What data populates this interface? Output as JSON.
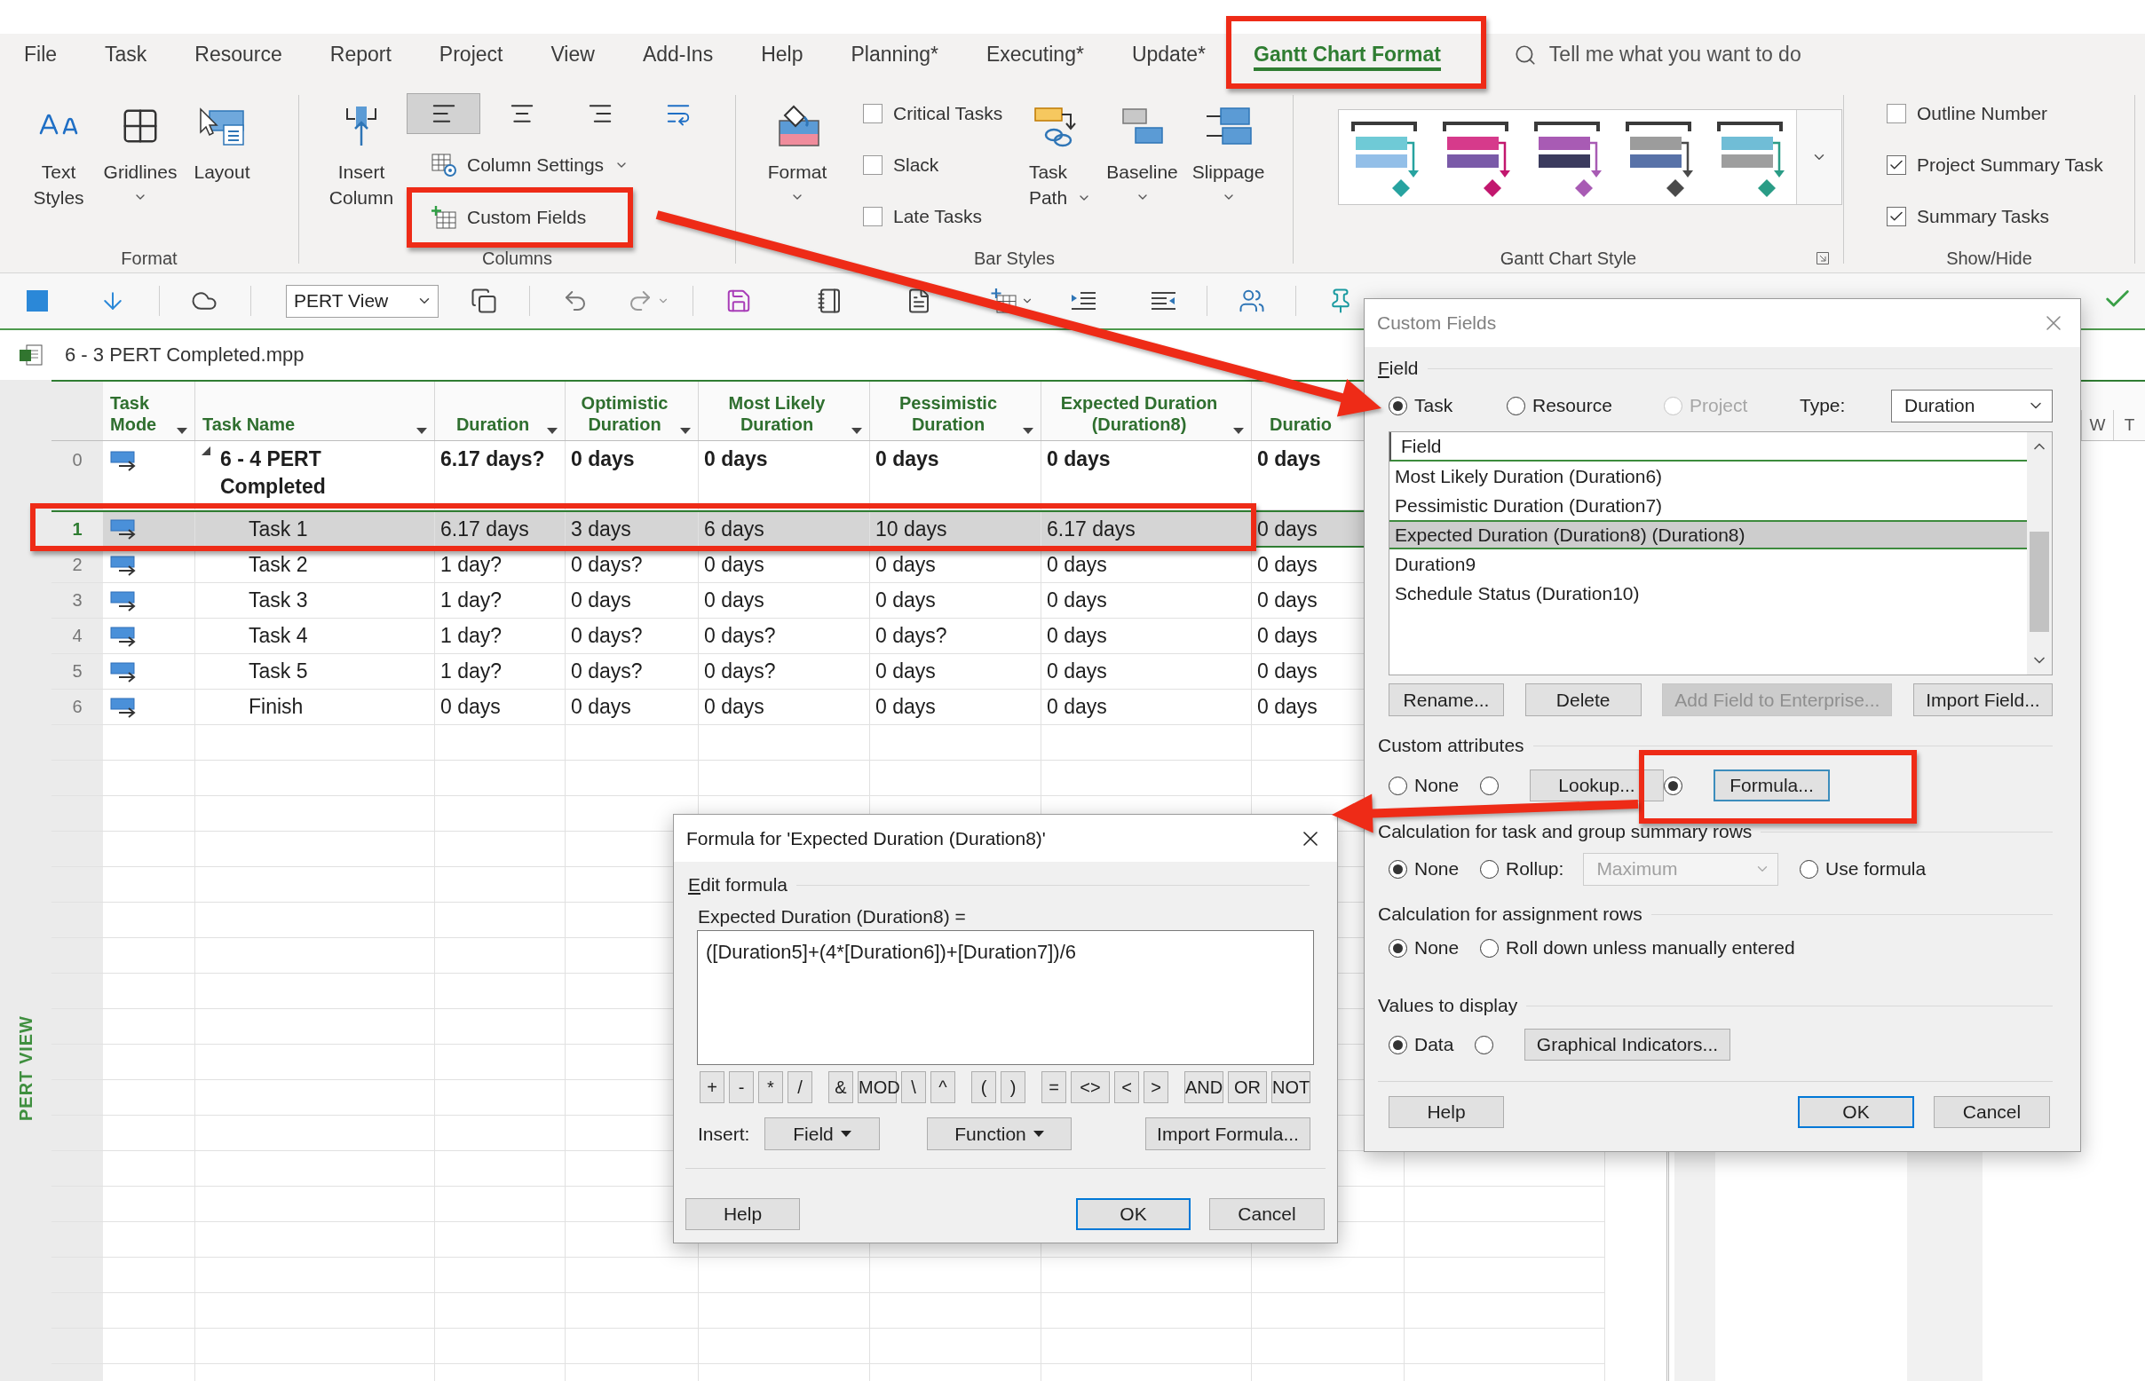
{
  "menu": {
    "tabs": [
      {
        "label": "File",
        "selected": false
      },
      {
        "label": "Task",
        "selected": false
      },
      {
        "label": "Resource",
        "selected": false
      },
      {
        "label": "Report",
        "selected": false
      },
      {
        "label": "Project",
        "selected": false
      },
      {
        "label": "View",
        "selected": false
      },
      {
        "label": "Add-Ins",
        "selected": false
      },
      {
        "label": "Help",
        "selected": false
      },
      {
        "label": "Planning*",
        "selected": false
      },
      {
        "label": "Executing*",
        "selected": false
      },
      {
        "label": "Update*",
        "selected": false
      },
      {
        "label": "Gantt Chart Format",
        "selected": true
      }
    ],
    "search": {
      "placeholder": "Tell me what you want to do"
    }
  },
  "ribbon": {
    "format": {
      "label": "Format",
      "buttons": [
        {
          "kind": "text_styles",
          "label": "Text Styles",
          "dropdown": false
        },
        {
          "kind": "gridlines",
          "label": "Gridlines",
          "dropdown": true
        },
        {
          "kind": "layout",
          "label": "Layout",
          "dropdown": false
        }
      ]
    },
    "columns": {
      "label": "Columns",
      "insert_column": "Insert Column",
      "alignment": [
        {
          "kind": "left",
          "selected": true
        },
        {
          "kind": "center",
          "selected": false
        },
        {
          "kind": "right",
          "selected": false
        }
      ],
      "column_settings": "Column Settings",
      "custom_fields": "Custom Fields"
    },
    "bar_styles": {
      "label": "Bar Styles",
      "format": {
        "label": "Format",
        "dropdown": true
      },
      "checkboxes": [
        {
          "label": "Critical Tasks",
          "checked": false
        },
        {
          "label": "Slack",
          "checked": false
        },
        {
          "label": "Late Tasks",
          "checked": false
        }
      ],
      "buttons": [
        {
          "kind": "task_path",
          "label": "Task Path",
          "dropdown": true
        },
        {
          "kind": "baseline",
          "label": "Baseline",
          "dropdown": true
        },
        {
          "kind": "slippage",
          "label": "Slippage",
          "dropdown": true
        }
      ]
    },
    "gantt_style": {
      "label": "Gantt Chart Style",
      "styles": [
        {
          "bars": [
            {
              "color": "#6fcad6"
            },
            {
              "color": "#93bfe8"
            }
          ],
          "milestone": {
            "color": "#27a3a0"
          }
        },
        {
          "bars": [
            {
              "color": "#d63a8b"
            },
            {
              "color": "#7a5aa8"
            }
          ],
          "milestone": {
            "color": "#c2176e"
          }
        },
        {
          "bars": [
            {
              "color": "#a85bb4"
            },
            {
              "color": "#3b3b5e"
            }
          ],
          "milestone": {
            "color": "#a85bb4"
          }
        },
        {
          "bars": [
            {
              "color": "#9c9c9c"
            },
            {
              "color": "#5872a8"
            }
          ],
          "milestone": {
            "color": "#4a4a4a"
          }
        },
        {
          "bars": [
            {
              "color": "#70bdd6"
            },
            {
              "color": "#9e9e9e"
            }
          ],
          "milestone": {
            "color": "#2a9c86"
          }
        }
      ]
    },
    "show_hide": {
      "label": "Show/Hide",
      "checkboxes": [
        {
          "label": "Outline Number",
          "checked": false
        },
        {
          "label": "Project Summary Task",
          "checked": true
        },
        {
          "label": "Summary Tasks",
          "checked": true
        }
      ]
    }
  },
  "quick_toolbar": {
    "view": "PERT View"
  },
  "document": {
    "file_name": "6 - 3 PERT Completed.mpp",
    "view_label": "PERT VIEW"
  },
  "table": {
    "columns": [
      {
        "label": "Task Mode",
        "menu": true
      },
      {
        "label": "Task Name",
        "menu": true
      },
      {
        "label": "Duration",
        "menu": true
      },
      {
        "label": "Optimistic Duration",
        "menu": true
      },
      {
        "label": "Most Likely Duration",
        "menu": true
      },
      {
        "label": "Pessimistic Duration",
        "menu": true
      },
      {
        "label": "Expected Duration (Duration8)",
        "menu": true
      },
      {
        "label": "Duratio",
        "menu": false
      }
    ],
    "rows": [
      {
        "id": "0",
        "kind": "summary",
        "selected": false,
        "name": "6 - 4 PERT Completed",
        "values": [
          "6.17 days?",
          "0 days",
          "0 days",
          "0 days",
          "0 days",
          "0 days"
        ]
      },
      {
        "id": "1",
        "kind": "task",
        "selected": true,
        "name": "Task 1",
        "values": [
          "6.17 days",
          "3 days",
          "6 days",
          "10 days",
          "6.17 days",
          "0 days"
        ]
      },
      {
        "id": "2",
        "kind": "task",
        "selected": false,
        "name": "Task 2",
        "values": [
          "1 day?",
          "0 days?",
          "0 days",
          "0 days",
          "0 days",
          "0 days"
        ]
      },
      {
        "id": "3",
        "kind": "task",
        "selected": false,
        "name": "Task 3",
        "values": [
          "1 day?",
          "0 days",
          "0 days",
          "0 days",
          "0 days",
          "0 days"
        ]
      },
      {
        "id": "4",
        "kind": "task",
        "selected": false,
        "name": "Task 4",
        "values": [
          "1 day?",
          "0 days?",
          "0 days?",
          "0 days?",
          "0 days",
          "0 days"
        ]
      },
      {
        "id": "5",
        "kind": "task",
        "selected": false,
        "name": "Task 5",
        "values": [
          "1 day?",
          "0 days?",
          "0 days?",
          "0 days",
          "0 days",
          "0 days"
        ]
      },
      {
        "id": "6",
        "kind": "task",
        "selected": false,
        "name": "Finish",
        "values": [
          "0 days",
          "0 days",
          "0 days",
          "0 days",
          "0 days",
          "0 days"
        ]
      }
    ]
  },
  "gantt": {
    "timescale": [
      "W",
      "T"
    ]
  },
  "custom_fields_dialog": {
    "title": "Custom Fields",
    "active": false,
    "field_section": "Field",
    "entities": [
      {
        "label": "Task",
        "selected": true,
        "disabled": false
      },
      {
        "label": "Resource",
        "selected": false,
        "disabled": false
      },
      {
        "label": "Project",
        "selected": false,
        "disabled": true
      }
    ],
    "type": {
      "label": "Type:",
      "value": "Duration"
    },
    "list": {
      "header": "Field",
      "items": [
        {
          "label": "Most Likely Duration (Duration6)",
          "selected": false
        },
        {
          "label": "Pessimistic Duration (Duration7)",
          "selected": false
        },
        {
          "label": "Expected Duration (Duration8) (Duration8)",
          "selected": true
        },
        {
          "label": "Duration9",
          "selected": false
        },
        {
          "label": "Schedule Status (Duration10)",
          "selected": false
        }
      ]
    },
    "list_buttons": [
      {
        "label": "Rename...",
        "disabled": false
      },
      {
        "label": "Delete",
        "disabled": false
      },
      {
        "label": "Add Field to Enterprise...",
        "disabled": true
      },
      {
        "label": "Import Field...",
        "disabled": false
      }
    ],
    "attributes": {
      "label": "Custom attributes",
      "options": [
        {
          "kind": "radio",
          "label": "None",
          "selected": false
        },
        {
          "kind": "button",
          "label": "Lookup...",
          "selected": false
        },
        {
          "kind": "button",
          "label": "Formula...",
          "selected": true
        }
      ]
    },
    "summary_rows": {
      "label": "Calculation for task and group summary rows",
      "options": [
        {
          "kind": "radio",
          "label": "None",
          "selected": true
        },
        {
          "kind": "select",
          "label": "Rollup:",
          "value": "Maximum",
          "selected": false
        },
        {
          "kind": "radio",
          "label": "Use formula",
          "selected": false
        }
      ]
    },
    "assignment_rows": {
      "label": "Calculation for assignment rows",
      "options": [
        {
          "label": "None",
          "selected": true
        },
        {
          "label": "Roll down unless manually entered",
          "selected": false
        }
      ]
    },
    "values_to_display": {
      "label": "Values to display",
      "options": [
        {
          "kind": "radio",
          "label": "Data",
          "selected": true
        },
        {
          "kind": "button",
          "label": "Graphical Indicators...",
          "selected": false
        }
      ]
    },
    "buttons": [
      {
        "label": "Help",
        "default": false
      },
      {
        "label": "OK",
        "default": true
      },
      {
        "label": "Cancel",
        "default": false
      }
    ]
  },
  "formula_dialog": {
    "title": "Formula for 'Expected Duration (Duration8)'",
    "active": true,
    "section": "Edit formula",
    "field_label": "Expected Duration (Duration8) =",
    "formula": "([Duration5]+(4*[Duration6])+[Duration7])/6",
    "operator_groups": [
      [
        "+",
        "-",
        "*",
        "/"
      ],
      [
        "&",
        "MOD",
        "\\",
        "^"
      ],
      [
        "(",
        ")"
      ],
      [
        "=",
        "<>",
        "<",
        ">"
      ],
      [
        "AND",
        "OR",
        "NOT"
      ]
    ],
    "insert_label": "Insert:",
    "insert_buttons": [
      {
        "label": "Field",
        "menu": true
      },
      {
        "label": "Function",
        "menu": true
      },
      {
        "label": "Import Formula...",
        "menu": false
      }
    ],
    "buttons": [
      {
        "label": "Help",
        "default": false
      },
      {
        "label": "OK",
        "default": true
      },
      {
        "label": "Cancel",
        "default": false
      }
    ]
  }
}
